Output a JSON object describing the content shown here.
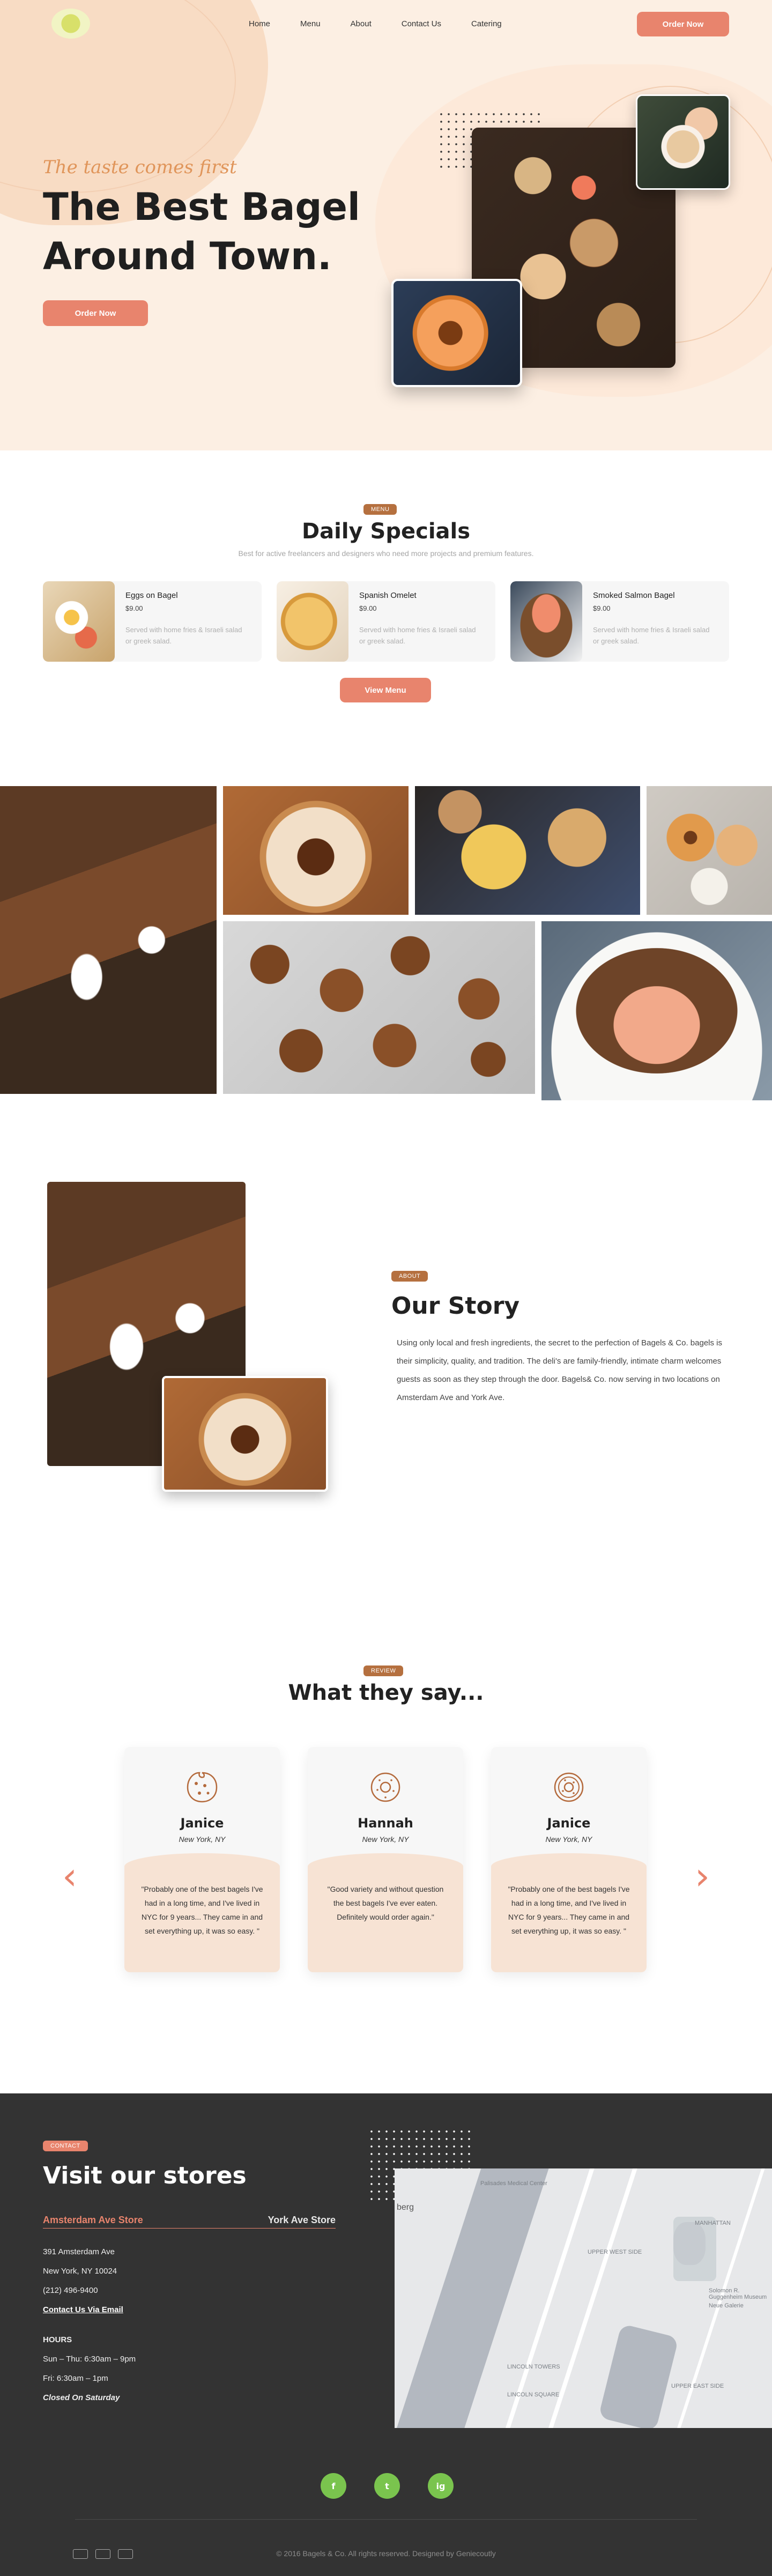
{
  "nav": {
    "items": [
      "Home",
      "Menu",
      "About",
      "Contact Us",
      "Catering"
    ],
    "order_button": "Order Now"
  },
  "hero": {
    "tagline": "The taste comes first",
    "title": "The Best Bagel Around Town.",
    "button": "Order Now"
  },
  "specials": {
    "badge": "MENU",
    "title": "Daily Specials",
    "subtitle": "Best for active freelancers and designers who need more projects and premium features.",
    "items": [
      {
        "name": "Eggs on Bagel",
        "price": "$9.00",
        "desc": "Served with home fries & Israeli salad or greek salad."
      },
      {
        "name": "Spanish Omelet",
        "price": "$9.00",
        "desc": "Served with home fries & Israeli salad or greek salad."
      },
      {
        "name": "Smoked Salmon Bagel",
        "price": "$9.00",
        "desc": "Served with home fries & Israeli salad or greek salad."
      }
    ],
    "button": "View Menu"
  },
  "story": {
    "badge": "ABOUT",
    "title": "Our Story",
    "text": "Using only local and fresh ingredients, the secret to the perfection of Bagels & Co. bagels is their simplicity, quality, and tradition.  The deli's are family-friendly, intimate charm welcomes guests as soon as they step through the door.  Bagels& Co. now serving in two locations on Amsterdam Ave and York Ave."
  },
  "reviews": {
    "badge": "REVIEW",
    "title": "What they say...",
    "items": [
      {
        "name": "Janice",
        "location": "New York, NY",
        "text": "\"Probably one of the best bagels I've had in a long time, and I've lived in NYC for 9 years... They came in and set everything up, it was so easy. \""
      },
      {
        "name": "Hannah",
        "location": "New York, NY",
        "text": "\"Good variety and without question the best bagels I've ever eaten. Definitely would order again.\""
      },
      {
        "name": "Janice",
        "location": "New York, NY",
        "text": "\"Probably one of the best bagels I've had in a long time, and I've lived in NYC for 9 years... They came in and set everything up, it was so easy. \""
      }
    ],
    "prev_icon": "chevron-left-icon",
    "next_icon": "chevron-right-icon"
  },
  "stores": {
    "badge": "CONTACT",
    "title": "Visit our stores",
    "tabs": [
      "Amsterdam Ave Store",
      "York Ave Store"
    ],
    "address_line1": "391 Amsterdam Ave",
    "address_line2": "New York, NY 10024",
    "phone": "(212) 496-9400",
    "email_link": "Contact Us Via Email",
    "hours_label": "HOURS",
    "hours_weekday": "Sun – Thu:  6:30am – 9pm",
    "hours_friday": "Fri:  6:30am – 1pm",
    "hours_closed": "Closed On Saturday",
    "map_labels": [
      "Palisades Medical Center",
      "berg",
      "UPPER WEST SIDE",
      "MANHATTAN",
      "Solomon R. Guggenheim Museum",
      "Neue Galerie",
      "LINCOLN TOWERS",
      "LINCOLN SQUARE",
      "UPPER EAST SIDE"
    ]
  },
  "footer": {
    "socials": [
      "f",
      "t",
      "ig"
    ],
    "copyright": "© 2016 Bagels & Co. All rights reserved. Designed by Geniecoutly"
  },
  "colors": {
    "accent": "#e8846d",
    "badge": "#b5703f",
    "hero_bg": "#fcefe3",
    "footer_bg": "#333333",
    "social": "#7ac44e"
  }
}
